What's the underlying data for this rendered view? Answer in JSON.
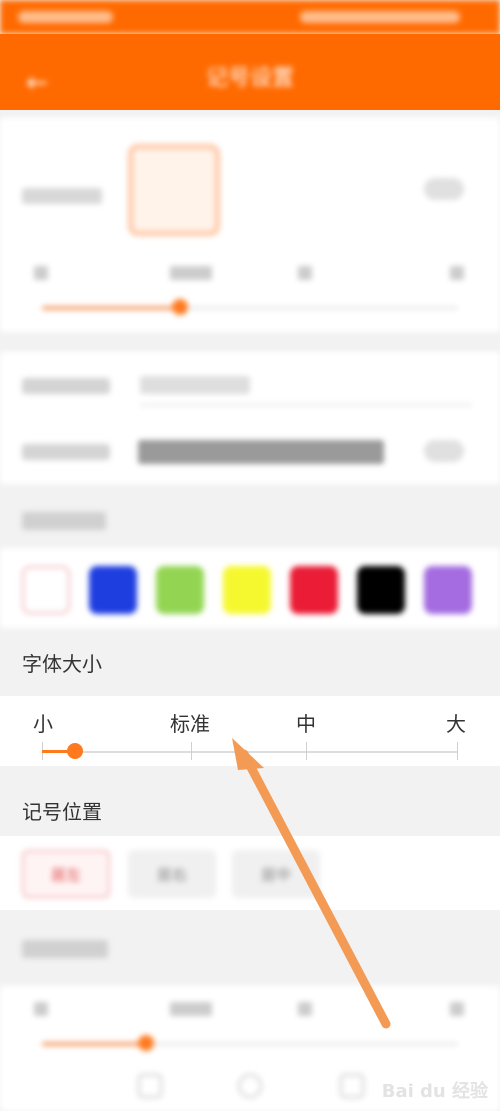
{
  "header": {
    "title": "记号设置"
  },
  "font_size": {
    "section_title": "字体大小",
    "labels": [
      "小",
      "标准",
      "中",
      "大"
    ],
    "value_fraction": 0.08
  },
  "mark_position": {
    "section_title": "记号位置",
    "options": [
      "居左",
      "居右",
      "居中"
    ],
    "selected": "居左"
  },
  "swatches": [
    "#ffffff",
    "#1f3ee0",
    "#93d553",
    "#f6f82f",
    "#ea1c36",
    "#000000",
    "#a46ce0"
  ],
  "colors": {
    "accent": "#ff6a00",
    "slider": "#ff7a1f",
    "arrow": "#f39a55"
  },
  "watermark": "Bai du 经验"
}
